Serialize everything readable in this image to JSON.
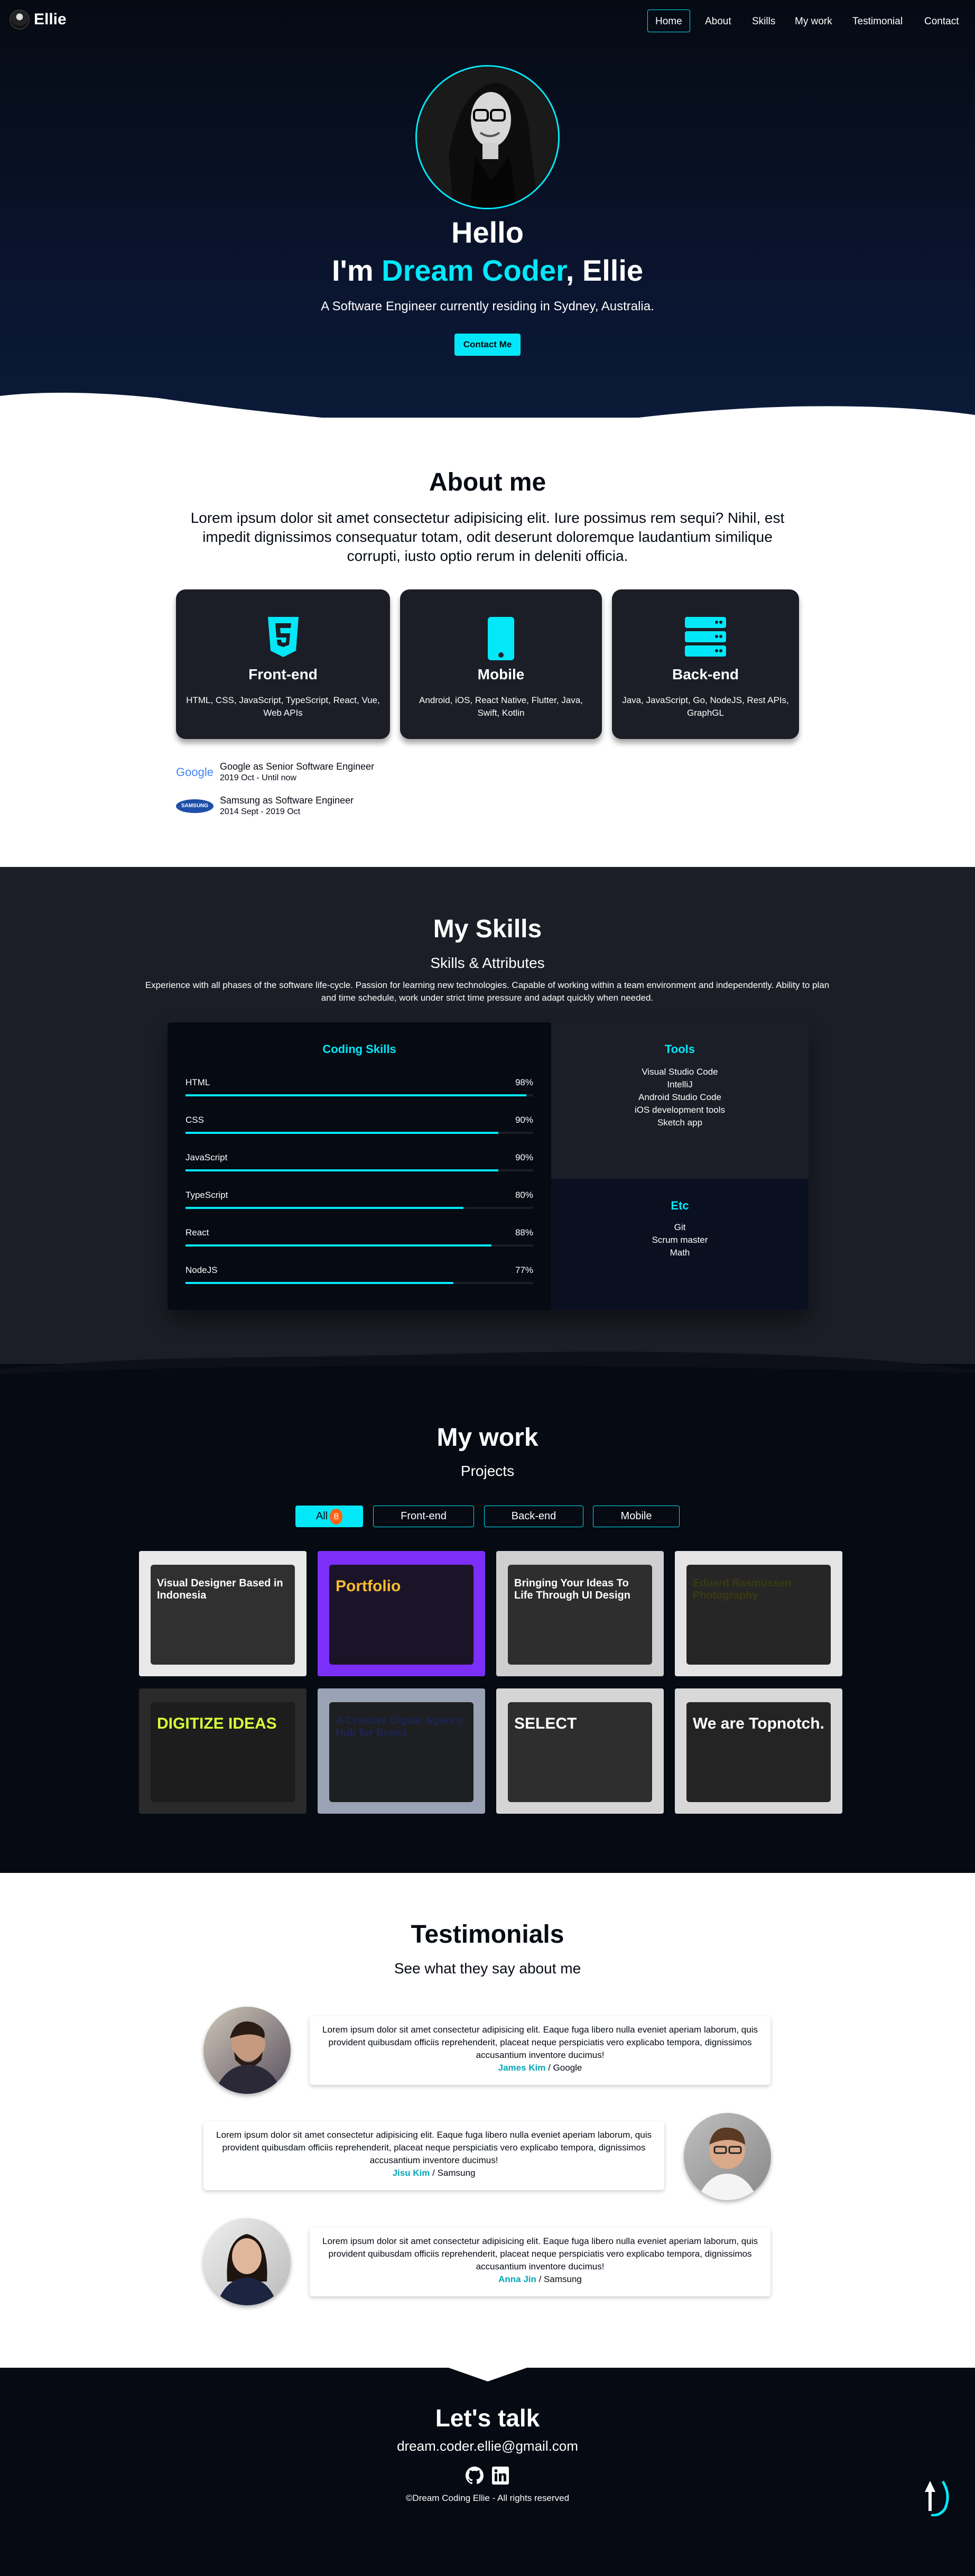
{
  "colors": {
    "accent": "#03e8f9",
    "dark": "#050a13",
    "grey": "#1b1e26",
    "badge": "#fd6413"
  },
  "navbar": {
    "logo": "Ellie",
    "items": [
      {
        "label": "Home",
        "active": true
      },
      {
        "label": "About"
      },
      {
        "label": "Skills"
      },
      {
        "label": "My work"
      },
      {
        "label": "Testimonial"
      },
      {
        "label": "Contact"
      }
    ]
  },
  "home": {
    "title": "Hello",
    "line_prefix": "I'm ",
    "line_accent": "Dream Coder",
    "line_suffix": ", Ellie",
    "description": "A Software Engineer currently residing in Sydney, Australia.",
    "contact_button": "Contact Me"
  },
  "about": {
    "title": "About me",
    "description": "Lorem ipsum dolor sit amet consectetur adipisicing elit. Iure possimus rem sequi? Nihil, est impedit dignissimos consequatur totam, odit deserunt doloremque laudantium similique corrupti, iusto optio rerum in deleniti officia.",
    "majors": [
      {
        "icon": "html5-icon",
        "title": "Front-end",
        "description": "HTML, CSS, JavaScript, TypeScript, React, Vue, Web APIs"
      },
      {
        "icon": "mobile-icon",
        "title": "Mobile",
        "description": "Android, iOS, React Native, Flutter, Java, Swift, Kotlin"
      },
      {
        "icon": "server-icon",
        "title": "Back-end",
        "description": "Java, JavaScript, Go, NodeJS, Rest APIs, GraphGL"
      }
    ],
    "jobs": [
      {
        "logo": "Google",
        "name": "Google as Senior Software Engineer",
        "period": "2019 Oct - Until now"
      },
      {
        "logo": "SAMSUNG",
        "name": "Samsung as Software Engineer",
        "period": "2014 Sept - 2019 Oct"
      }
    ]
  },
  "skills": {
    "title": "My Skills",
    "subtitle": "Skills & Attributes",
    "description": "Experience with all phases of the software life-cycle. Passion for learning new technologies. Capable of working within a team environment and independently. Ability to plan and time schedule, work under strict time pressure and adapt quickly when needed.",
    "coding_title": "Coding Skills",
    "coding": [
      {
        "name": "HTML",
        "percent": 98,
        "label": "98%"
      },
      {
        "name": "CSS",
        "percent": 90,
        "label": "90%"
      },
      {
        "name": "JavaScript",
        "percent": 90,
        "label": "90%"
      },
      {
        "name": "TypeScript",
        "percent": 80,
        "label": "80%"
      },
      {
        "name": "React",
        "percent": 88,
        "label": "88%"
      },
      {
        "name": "NodeJS",
        "percent": 77,
        "label": "77%"
      }
    ],
    "tools_title": "Tools",
    "tools": [
      "Visual Studio Code",
      "IntelliJ",
      "Android Studio Code",
      "iOS development tools",
      "Sketch app"
    ],
    "etc_title": "Etc",
    "etc": [
      "Git",
      "Scrum master",
      "Math"
    ]
  },
  "work": {
    "title": "My work",
    "subtitle": "Projects",
    "categories": [
      {
        "label": "All",
        "count": "8",
        "active": true
      },
      {
        "label": "Front-end"
      },
      {
        "label": "Back-end"
      },
      {
        "label": "Mobile"
      }
    ],
    "projects": [
      {
        "headline": "Visual Designer Based in Indonesia",
        "bg": "#e9e9e9",
        "fg": "#1c1c1c"
      },
      {
        "headline": "Portfolio",
        "bg": "#7b2ff7",
        "fg": "#fbbc2f"
      },
      {
        "headline": "Bringing Your Ideas To Life Through UI Design",
        "bg": "#cfcfcf",
        "fg": "#1f1f1f"
      },
      {
        "headline": "Eduard Rasmussen Photography",
        "bg": "#e4e4e4",
        "fg": "#3a3a10"
      },
      {
        "headline": "DIGITIZE IDEAS",
        "bg": "#2a2a2a",
        "fg": "#d9ff3c"
      },
      {
        "headline": "A Creative Digital Agency Hub for Brand.",
        "bg": "#9aa3b5",
        "fg": "#1d2454"
      },
      {
        "headline": "SELECT",
        "bg": "#d5d5d5",
        "fg": "#111"
      },
      {
        "headline": "We are Topnotch.",
        "bg": "#d8d8d8",
        "fg": "#111"
      }
    ]
  },
  "testimonials": {
    "title": "Testimonials",
    "subtitle": "See what they say about me",
    "items": [
      {
        "text": "Lorem ipsum dolor sit amet consectetur adipisicing elit. Eaque fuga libero nulla eveniet aperiam laborum, quis provident quibusdam officiis reprehenderit, placeat neque perspiciatis vero explicabo tempora, dignissimos accusantium inventore ducimus!",
        "name": "James Kim",
        "company": " / Google"
      },
      {
        "text": "Lorem ipsum dolor sit amet consectetur adipisicing elit. Eaque fuga libero nulla eveniet aperiam laborum, quis provident quibusdam officiis reprehenderit, placeat neque perspiciatis vero explicabo tempora, dignissimos accusantium inventore ducimus!",
        "name": "Jisu Kim",
        "company": " / Samsung"
      },
      {
        "text": "Lorem ipsum dolor sit amet consectetur adipisicing elit. Eaque fuga libero nulla eveniet aperiam laborum, quis provident quibusdam officiis reprehenderit, placeat neque perspiciatis vero explicabo tempora, dignissimos accusantium inventore ducimus!",
        "name": "Anna Jin",
        "company": " / Samsung"
      }
    ]
  },
  "contact": {
    "title": "Let's talk",
    "email": "dream.coder.ellie@gmail.com",
    "links": [
      {
        "icon": "github-icon"
      },
      {
        "icon": "linkedin-icon"
      }
    ],
    "rights": "©Dream Coding Ellie - All rights reserved"
  }
}
